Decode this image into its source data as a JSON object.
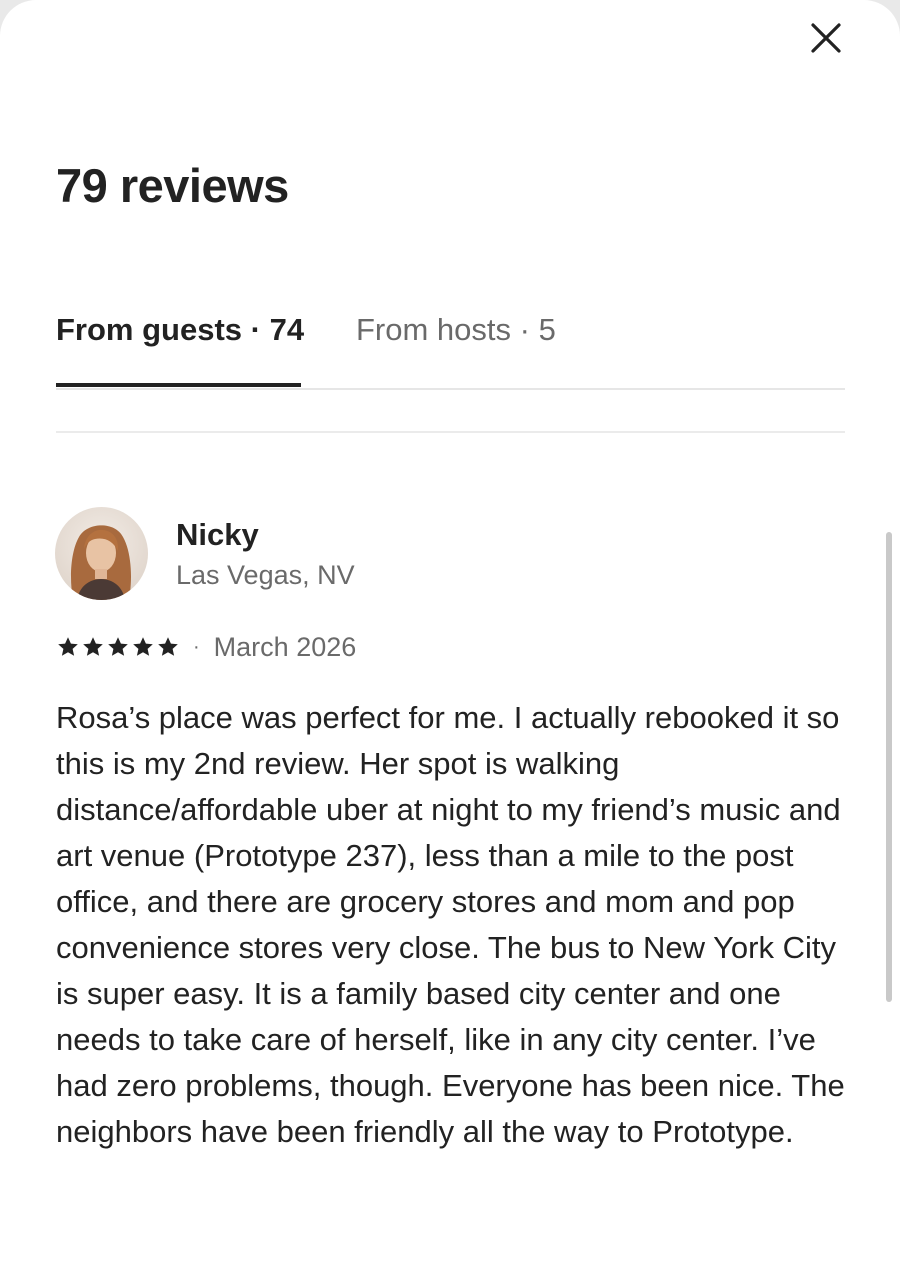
{
  "modal": {
    "title": "79 reviews",
    "close_icon": "close-icon"
  },
  "tabs": [
    {
      "label": "From guests · 74",
      "active": true
    },
    {
      "label": "From hosts · 5",
      "active": false
    }
  ],
  "review": {
    "reviewer_name": "Nicky",
    "reviewer_location": "Las Vegas, NV",
    "rating": 5,
    "rating_max": 5,
    "separator": "·",
    "date": "March 2026",
    "text": "Rosa’s place was perfect for me. I actually rebooked it so this is my 2nd review. Her spot is walking distance/affordable uber at night to my friend’s music and art venue (Prototype 237), less than a mile to the post office, and there are grocery stores and mom and pop convenience stores very close. The bus to New York City is super easy. It is a family based city center and one needs to take care of herself, like in any city center. I’ve had zero problems, though. Everyone has been nice. The neighbors have been friendly all the way to Prototype."
  },
  "colors": {
    "text_primary": "#222222",
    "text_secondary": "#6a6a6a",
    "divider": "#ebebeb",
    "star": "#222222"
  }
}
